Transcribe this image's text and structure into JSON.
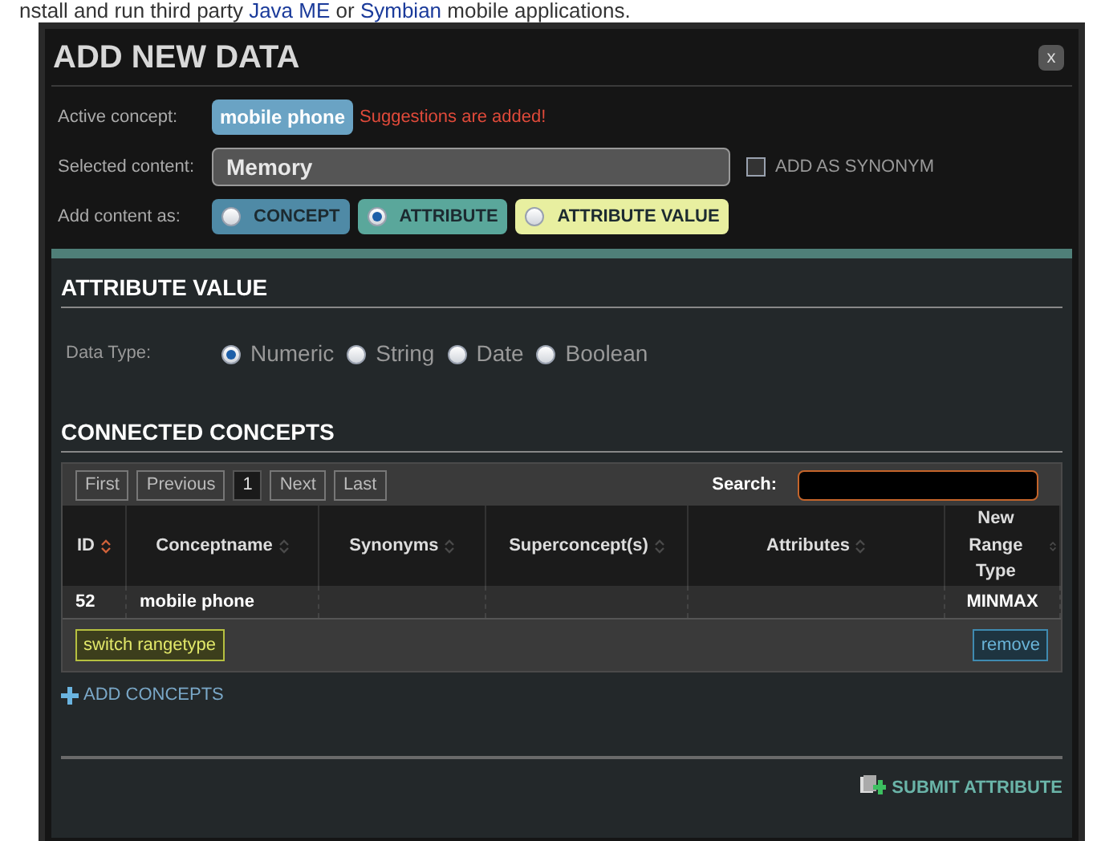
{
  "background_text": [
    {
      "kind": "text",
      "text": "nstall and run third party "
    },
    {
      "kind": "link",
      "text": "Java ME"
    },
    {
      "kind": "text",
      "text": " or "
    },
    {
      "kind": "link",
      "text": "Symbian"
    },
    {
      "kind": "text",
      "text": " mobile applications."
    }
  ],
  "dialog": {
    "title": "ADD NEW DATA",
    "close": "x",
    "active_concept": {
      "label": "Active concept:",
      "tag": "mobile phone",
      "message": "Suggestions are added!"
    },
    "selected_content": {
      "label": "Selected content:",
      "value": "Memory",
      "synonym": {
        "label": "ADD AS SYNONYM",
        "checked": false
      }
    },
    "add_content_as": {
      "label": "Add content as:",
      "options": [
        {
          "label": "CONCEPT",
          "selected": false,
          "color": "#4f8aa6"
        },
        {
          "label": "ATTRIBUTE",
          "selected": true,
          "color": "#5aa79b"
        },
        {
          "label": "ATTRIBUTE VALUE",
          "selected": false,
          "color": "#e8efa0"
        }
      ]
    },
    "attribute_value": {
      "heading": "ATTRIBUTE VALUE",
      "data_type_label": "Data Type:",
      "options": [
        {
          "label": "Numeric",
          "selected": true
        },
        {
          "label": "String",
          "selected": false
        },
        {
          "label": "Date",
          "selected": false
        },
        {
          "label": "Boolean",
          "selected": false
        }
      ]
    },
    "connected_concepts": {
      "heading": "CONNECTED CONCEPTS",
      "pager": [
        {
          "label": "First",
          "selected": false
        },
        {
          "label": "Previous",
          "selected": false
        },
        {
          "label": "1",
          "selected": true
        },
        {
          "label": "Next",
          "selected": false
        },
        {
          "label": "Last",
          "selected": false
        }
      ],
      "search_label": "Search:",
      "table": {
        "columns": [
          {
            "label": "ID",
            "sorted": true
          },
          {
            "label": "Conceptname",
            "sorted": false
          },
          {
            "label": "Synonyms",
            "sorted": false
          },
          {
            "label": "Superconcept(s)",
            "sorted": false
          },
          {
            "label": "Attributes",
            "sorted": false
          },
          {
            "label": "New Range Type",
            "sorted": false
          }
        ],
        "rows": [
          [
            "52",
            "mobile phone",
            "",
            "",
            "",
            "MINMAX"
          ]
        ]
      },
      "switch_button": "switch rangetype",
      "remove_button": "remove"
    },
    "add_concepts": "ADD CONCEPTS",
    "submit": "SUBMIT ATTRIBUTE"
  }
}
